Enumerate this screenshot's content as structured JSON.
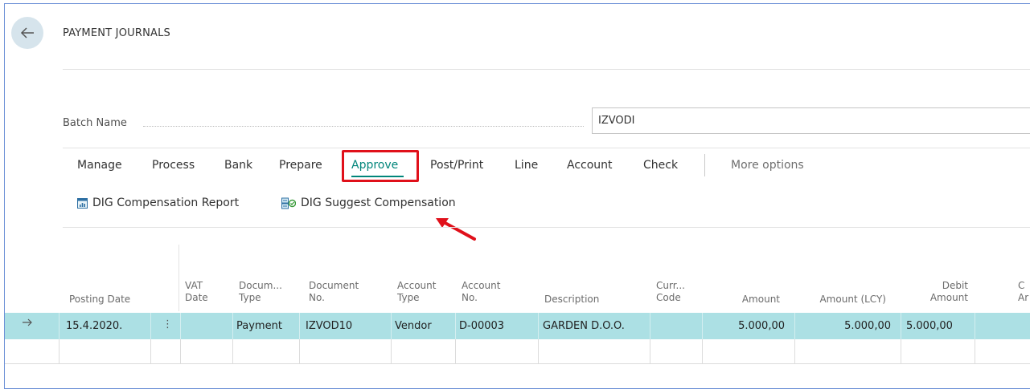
{
  "page": {
    "title": "PAYMENT JOURNALS"
  },
  "batch": {
    "label": "Batch Name",
    "value": "IZVODI"
  },
  "menu": {
    "items": [
      "Manage",
      "Process",
      "Bank",
      "Prepare",
      "Approve",
      "Post/Print",
      "Line",
      "Account",
      "Check"
    ],
    "active": "Approve",
    "more": "More options"
  },
  "actions": {
    "compensation_report": "DIG Compensation Report",
    "suggest_compensation": "DIG Suggest Compensation"
  },
  "table": {
    "headers": {
      "posting_date": "Posting Date",
      "vat_date_1": "VAT",
      "vat_date_2": "Date",
      "doc_type_1": "Docum...",
      "doc_type_2": "Type",
      "doc_no_1": "Document",
      "doc_no_2": "No.",
      "acc_type_1": "Account",
      "acc_type_2": "Type",
      "acc_no_1": "Account",
      "acc_no_2": "No.",
      "description": "Description",
      "curr_1": "Curr...",
      "curr_2": "Code",
      "amount": "Amount",
      "amount_lcy": "Amount (LCY)",
      "debit_1": "Debit",
      "debit_2": "Amount",
      "credit_1": "C",
      "credit_2": "Ar"
    },
    "row": {
      "posting_date": "15.4.2020.",
      "menu_glyph": "⋮",
      "doc_type": "Payment",
      "doc_no": "IZVOD10",
      "acc_type": "Vendor",
      "acc_no": "D-00003",
      "description": "GARDEN D.O.O.",
      "amount": "5.000,00",
      "amount_lcy": "5.000,00",
      "debit": "5.000,00"
    }
  },
  "colors": {
    "accent": "#00857a",
    "highlight_box": "#e0101a",
    "selected_row": "#ace0e4",
    "frame_border": "#6b8fd6"
  }
}
